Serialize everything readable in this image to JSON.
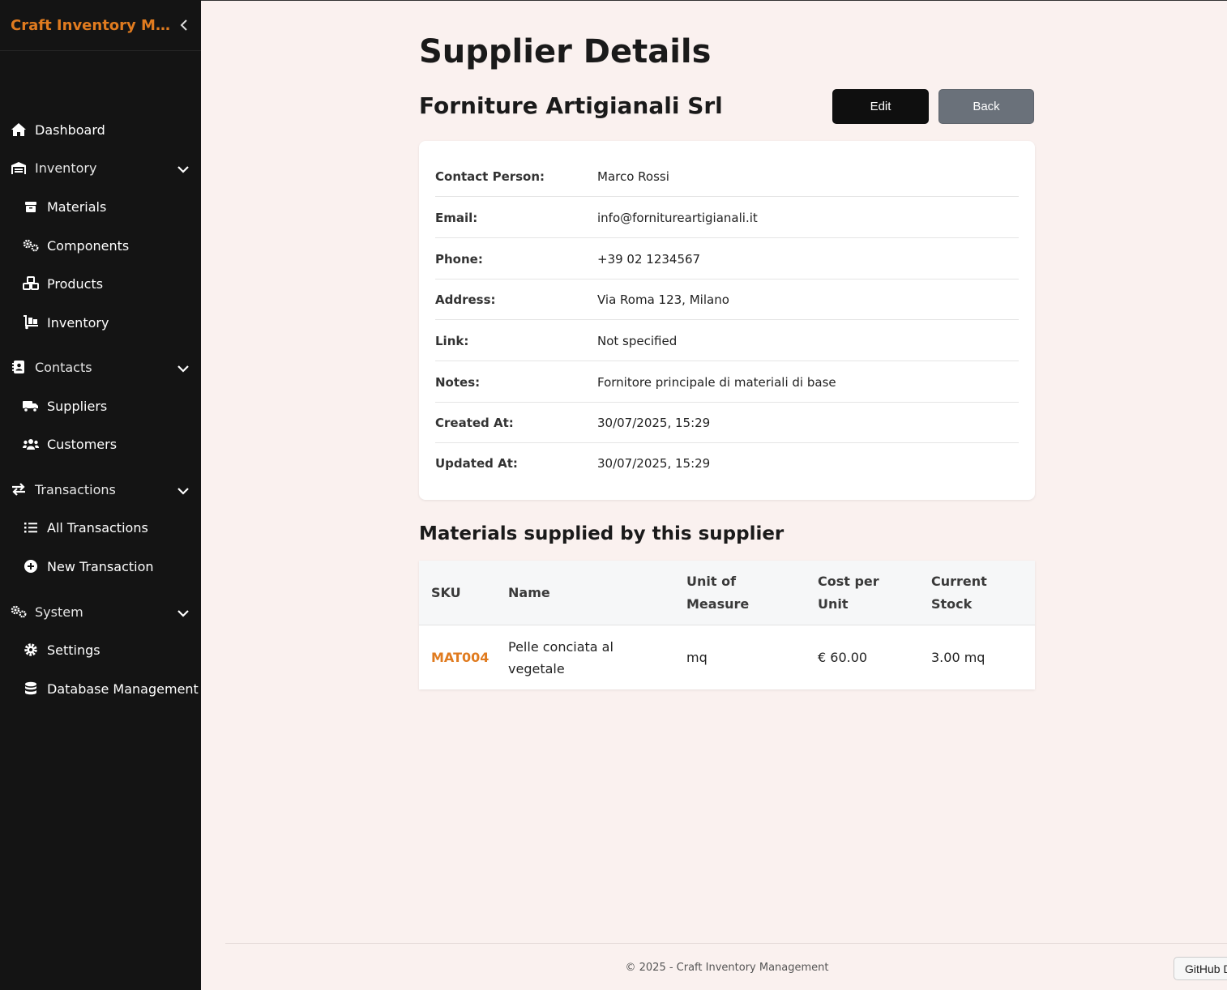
{
  "app": {
    "title": "Craft Inventory Management"
  },
  "sidebar": {
    "dashboard": "Dashboard",
    "inventory_group": "Inventory",
    "materials": "Materials",
    "components": "Components",
    "products": "Products",
    "inventory": "Inventory",
    "contacts_group": "Contacts",
    "suppliers": "Suppliers",
    "customers": "Customers",
    "transactions_group": "Transactions",
    "all_transactions": "All Transactions",
    "new_transaction": "New Transaction",
    "system_group": "System",
    "settings": "Settings",
    "database_management": "Database Management"
  },
  "page": {
    "title": "Supplier Details",
    "supplier_name": "Forniture Artigianali Srl",
    "edit_label": "Edit",
    "back_label": "Back"
  },
  "details": {
    "contact_label": "Contact Person:",
    "contact_value": "Marco Rossi",
    "email_label": "Email:",
    "email_value": "info@fornitureartigianali.it",
    "phone_label": "Phone:",
    "phone_value": "+39 02 1234567",
    "address_label": "Address:",
    "address_value": "Via Roma 123, Milano",
    "link_label": "Link:",
    "link_value": "Not specified",
    "notes_label": "Notes:",
    "notes_value": "Fornitore principale di materiali di base",
    "created_label": "Created At:",
    "created_value": "30/07/2025, 15:29",
    "updated_label": "Updated At:",
    "updated_value": "30/07/2025, 15:29"
  },
  "materials": {
    "section_title": "Materials supplied by this supplier",
    "headers": {
      "sku": "SKU",
      "name": "Name",
      "unit": "Unit of Measure",
      "cost": "Cost per Unit",
      "stock": "Current Stock"
    },
    "rows": [
      {
        "sku": "MAT004",
        "name": "Pelle conciata al vegetale",
        "unit": "mq",
        "cost": "€ 60.00",
        "stock": "3.00 mq"
      }
    ]
  },
  "footer": {
    "text": "© 2025 - Craft Inventory Management",
    "github": "GitHub D"
  },
  "colors": {
    "accent": "#e07b1f",
    "sidebar_bg": "#141414",
    "page_bg": "#faf1ef"
  }
}
